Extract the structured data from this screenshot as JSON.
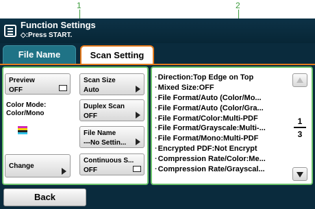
{
  "callouts": [
    "1",
    "2"
  ],
  "header": {
    "title": "Function Settings",
    "subtitle": "◇:Press START."
  },
  "tabs": [
    {
      "label": "File Name",
      "active": false
    },
    {
      "label": "Scan Setting",
      "active": true
    }
  ],
  "left": {
    "preview": {
      "label": "Preview",
      "value": "OFF"
    },
    "color_mode": {
      "label": "Color Mode:",
      "value": "Color/Mono"
    },
    "change_label": "Change",
    "scan_size": {
      "label": "Scan Size",
      "value": "Auto"
    },
    "duplex_scan": {
      "label": "Duplex Scan",
      "value": "OFF"
    },
    "file_name": {
      "label": "File Name",
      "value": "---No Settin..."
    },
    "continuous": {
      "label": "Continuous S...",
      "value": "OFF"
    }
  },
  "settings_list": [
    "Direction:Top Edge on Top",
    "Mixed Size:OFF",
    "File Format/Auto (Color/Mo...",
    "File Format/Auto (Color/Gra...",
    "File Format/Color:Multi-PDF",
    "File Format/Grayscale:Multi-...",
    "File Format/Mono:Multi-PDF",
    "Encrypted PDF:Not Encrypt",
    "Compression Rate/Color:Me...",
    "Compression Rate/Grayscal..."
  ],
  "pager": {
    "current": "1",
    "total": "3"
  },
  "footer": {
    "back_label": "Back"
  },
  "colors": {
    "accent": "#e57a1c",
    "frame": "#6cc46c",
    "dark_bg": "#0a2b3d"
  }
}
